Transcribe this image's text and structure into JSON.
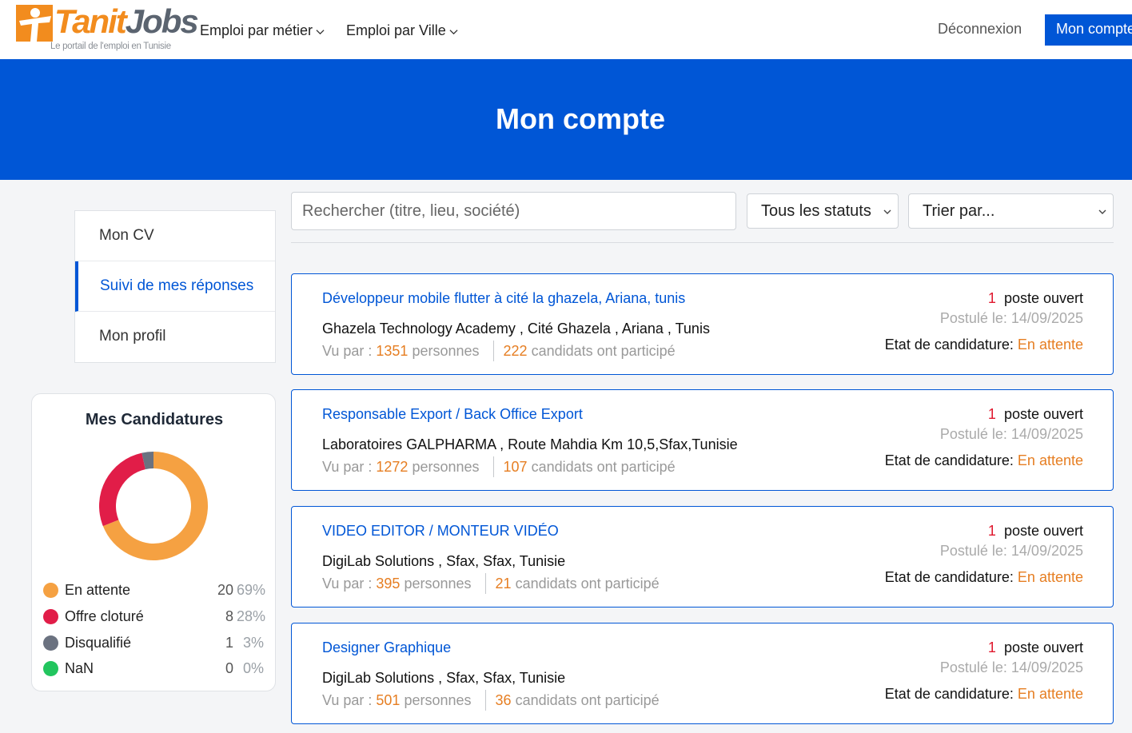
{
  "header": {
    "logo": {
      "brand_tanit": "Tanit",
      "brand_jobs": "Jobs",
      "tagline": "Le portail de l'emploi en Tunisie"
    },
    "nav": [
      {
        "label": "Emploi par métier"
      },
      {
        "label": "Emploi par Ville"
      }
    ],
    "logout_label": "Déconnexion",
    "account_label": "Mon compte"
  },
  "banner": {
    "title": "Mon compte"
  },
  "sidebar": {
    "items": [
      {
        "label": "Mon CV"
      },
      {
        "label": "Suivi de mes réponses"
      },
      {
        "label": "Mon profil"
      }
    ]
  },
  "candidatures": {
    "title": "Mes Candidatures",
    "legend": [
      {
        "label": "En attente",
        "count": "20",
        "pct": "69%",
        "color": "#f5a142"
      },
      {
        "label": "Offre cloturé",
        "count": "8",
        "pct": "28%",
        "color": "#e11d48"
      },
      {
        "label": "Disqualifié",
        "count": "1",
        "pct": "3%",
        "color": "#6b7280"
      },
      {
        "label": "NaN",
        "count": "0",
        "pct": "0%",
        "color": "#22c55e"
      }
    ]
  },
  "chart_data": {
    "type": "pie",
    "title": "Mes Candidatures",
    "categories": [
      "En attente",
      "Offre cloturé",
      "Disqualifié",
      "NaN"
    ],
    "values": [
      20,
      8,
      1,
      0
    ],
    "colors": [
      "#f5a142",
      "#e11d48",
      "#6b7280",
      "#22c55e"
    ]
  },
  "filters": {
    "search_placeholder": "Rechercher (titre, lieu, société)",
    "status_label": "Tous les statuts",
    "sort_label": "Trier par..."
  },
  "jobs": [
    {
      "title": "Développeur mobile flutter à cité la ghazela, Ariana, tunis",
      "company": "Ghazela Technology Academy , Cité Ghazela , Ariana , Tunis",
      "views": "1351",
      "views_prefix": "Vu par : ",
      "views_suffix": " personnes",
      "candidates": "222",
      "candidates_suffix": " candidats ont participé",
      "open_count": "1",
      "open_label": " poste ouvert",
      "date": "Postulé le: 14/09/2025",
      "status_prefix": "Etat de candidature: ",
      "status": "En attente"
    },
    {
      "title": "Responsable Export / Back Office Export",
      "company": "Laboratoires GALPHARMA , Route Mahdia Km 10,5,Sfax,Tunisie",
      "views": "1272",
      "views_prefix": "Vu par : ",
      "views_suffix": " personnes",
      "candidates": "107",
      "candidates_suffix": " candidats ont participé",
      "open_count": "1",
      "open_label": " poste ouvert",
      "date": "Postulé le: 14/09/2025",
      "status_prefix": "Etat de candidature: ",
      "status": "En attente"
    },
    {
      "title": "VIDEO EDITOR / MONTEUR VIDÉO",
      "company": "DigiLab Solutions , Sfax, Sfax, Tunisie",
      "views": "395",
      "views_prefix": "Vu par : ",
      "views_suffix": " personnes",
      "candidates": "21",
      "candidates_suffix": " candidats ont participé",
      "open_count": "1",
      "open_label": " poste ouvert",
      "date": "Postulé le: 14/09/2025",
      "status_prefix": "Etat de candidature: ",
      "status": "En attente"
    },
    {
      "title": "Designer Graphique",
      "company": "DigiLab Solutions , Sfax, Sfax, Tunisie",
      "views": "501",
      "views_prefix": "Vu par : ",
      "views_suffix": " personnes",
      "candidates": "36",
      "candidates_suffix": " candidats ont participé",
      "open_count": "1",
      "open_label": " poste ouvert",
      "date": "Postulé le: 14/09/2025",
      "status_prefix": "Etat de candidature: ",
      "status": "En attente"
    }
  ]
}
